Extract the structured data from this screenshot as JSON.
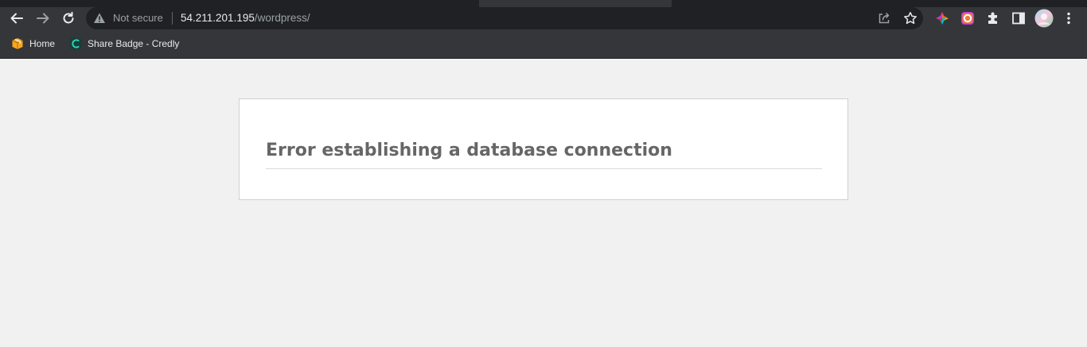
{
  "browser": {
    "security_label": "Not secure",
    "url_host": "54.211.201.195",
    "url_path": "/wordpress/",
    "icons": [
      "back-icon",
      "forward-icon",
      "reload-icon",
      "warning-icon",
      "share-icon",
      "star-icon",
      "extension-icon",
      "extension-icon",
      "puzzle-icon",
      "side-panel-icon",
      "avatar",
      "menu-icon"
    ]
  },
  "bookmarks": [
    {
      "label": "Home",
      "icon": "box-icon"
    },
    {
      "label": "Share Badge - Credly",
      "icon": "credly-icon"
    }
  ],
  "page": {
    "error_heading": "Error establishing a database connection"
  },
  "colors": {
    "page_bg": "#f1f1f1",
    "card_border": "#ccd0d4",
    "heading": "#666666",
    "chrome_toolbar": "#35363a"
  }
}
